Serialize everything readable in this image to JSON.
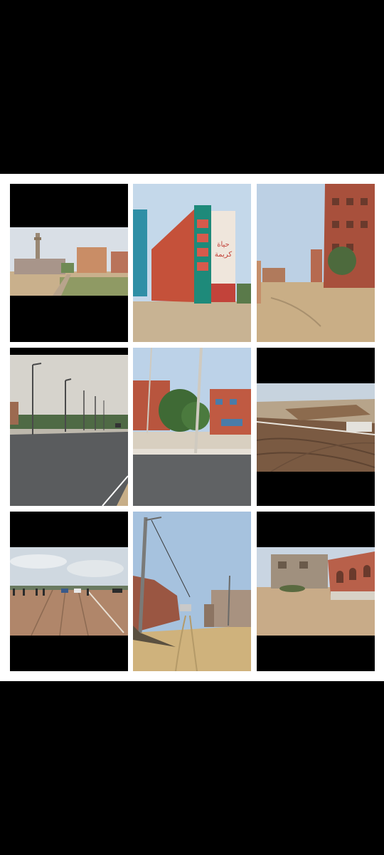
{
  "collage": {
    "photos": [
      {
        "subject": "street-with-minaret"
      },
      {
        "subject": "school-building"
      },
      {
        "subject": "brick-apartments-dirt-lot"
      },
      {
        "subject": "highway-with-streetlights"
      },
      {
        "subject": "road-with-brick-houses"
      },
      {
        "subject": "plowed-plots-with-boundary"
      },
      {
        "subject": "plowed-field-with-people"
      },
      {
        "subject": "dirt-road-with-utility-pole"
      },
      {
        "subject": "unfinished-brick-buildings"
      }
    ]
  },
  "school_sign": {
    "line1": "حياة",
    "line2": "كريمة"
  },
  "colors": {
    "background": "#000000",
    "panel": "#ffffff",
    "brick": "#b0503a",
    "sand": "#cdb08a",
    "sky": "#b9d0e6"
  }
}
